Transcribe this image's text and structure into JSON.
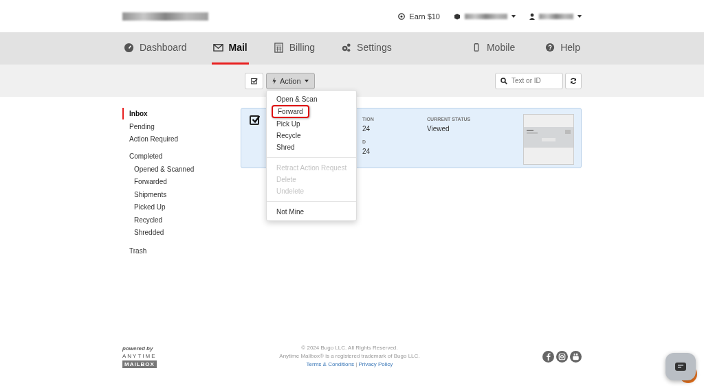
{
  "header": {
    "earn": "Earn $10"
  },
  "nav": [
    {
      "label": "Dashboard",
      "selected": false
    },
    {
      "label": "Mail",
      "selected": true
    },
    {
      "label": "Billing",
      "selected": false
    },
    {
      "label": "Settings",
      "selected": false
    }
  ],
  "nav_right": [
    {
      "label": "Mobile"
    },
    {
      "label": "Help"
    }
  ],
  "toolbar": {
    "action": "Action",
    "search_placeholder": "Text or ID"
  },
  "sidebar": [
    {
      "label": "Inbox",
      "selected": true
    },
    {
      "label": "Pending",
      "selected": false
    },
    {
      "label": "Action Required",
      "selected": false
    },
    {
      "label": "Completed",
      "selected": false,
      "children": [
        {
          "label": "Opened & Scanned",
          "selected": false
        },
        {
          "label": "Forwarded",
          "selected": false
        },
        {
          "label": "Shipments",
          "selected": false
        },
        {
          "label": "Picked Up",
          "selected": false
        },
        {
          "label": "Recycled",
          "selected": false
        },
        {
          "label": "Shredded",
          "selected": false
        }
      ]
    },
    {
      "label": "Trash",
      "selected": false
    }
  ],
  "mail_item": {
    "checked": true,
    "fragments": [
      {
        "label": "TION",
        "value": "24"
      },
      {
        "label": "D",
        "value": "24"
      }
    ],
    "status_label": "CURRENT STATUS",
    "status": "Viewed"
  },
  "menu": [
    [
      {
        "label": "Open & Scan",
        "disabled": false,
        "highlighted": false
      },
      {
        "label": "Forward",
        "disabled": false,
        "highlighted": true
      },
      {
        "label": "Pick Up",
        "disabled": false,
        "highlighted": false
      },
      {
        "label": "Recycle",
        "disabled": false,
        "highlighted": false
      },
      {
        "label": "Shred",
        "disabled": false,
        "highlighted": false
      }
    ],
    [
      {
        "label": "Retract Action Request",
        "disabled": true,
        "highlighted": false
      },
      {
        "label": "Delete",
        "disabled": true,
        "highlighted": false
      },
      {
        "label": "Undelete",
        "disabled": true,
        "highlighted": false
      }
    ],
    [
      {
        "label": "Not Mine",
        "disabled": false,
        "highlighted": false
      }
    ]
  ],
  "footer": {
    "powered": "powered by",
    "brand1": "ANYTIME",
    "brand2": "MAILBOX",
    "copyright": "© 2024 Bugo LLC. All Rights Reserved.",
    "trademark": "Anytime Mailbox® is a registered trademark of Bugo LLC.",
    "terms": "Terms & Conditions",
    "sep": "|",
    "privacy": "Privacy Policy"
  }
}
